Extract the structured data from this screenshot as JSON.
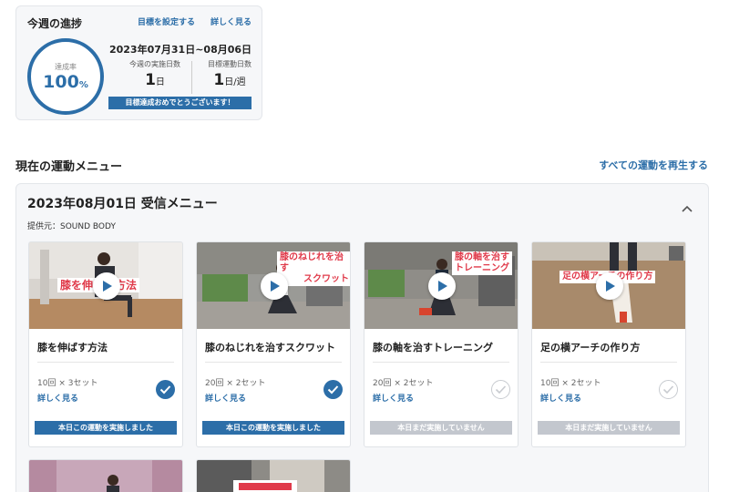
{
  "progress": {
    "title": "今週の進捗",
    "set_goal_link": "目標を設定する",
    "detail_link": "詳しく見る",
    "rate_label": "達成率",
    "rate_value": "100",
    "rate_unit": "%",
    "rate_fraction": 1.0,
    "period": "2023年07月31日~08月06日",
    "done_days_label": "今週の実施日数",
    "done_days_value": "1",
    "done_days_unit": "日",
    "goal_days_label": "目標運動日数",
    "goal_days_value": "1",
    "goal_days_unit": "日/週",
    "banner": "目標達成おめでとうございます！",
    "accent_color": "#2c6ea8"
  },
  "section": {
    "title": "現在の運動メニュー",
    "play_all": "すべての運動を再生する"
  },
  "menu": {
    "title": "2023年08月01日 受信メニュー",
    "provider": "提供元：SOUND BODY",
    "collapse_icon": "chevron-up-icon",
    "cards": [
      {
        "caption": "膝を伸ばす方法",
        "name": "膝を伸ばす方法",
        "reps": "10回 × 3セット",
        "detail": "詳しく見る",
        "status": "本日この運動を実施しました",
        "done": true
      },
      {
        "caption": "膝のねじれを治す スクワット",
        "name": "膝のねじれを治すスクワット",
        "reps": "20回 × 2セット",
        "detail": "詳しく見る",
        "status": "本日この運動を実施しました",
        "done": true
      },
      {
        "caption": "膝の軸を治す トレーニング",
        "name": "膝の軸を治すトレーニング",
        "reps": "20回 × 2セット",
        "detail": "詳しく見る",
        "status": "本日まだ実施していません",
        "done": false
      },
      {
        "caption": "足の横アーチの作り方",
        "name": "足の横アーチの作り方",
        "reps": "10回 × 2セット",
        "detail": "詳しく見る",
        "status": "本日まだ実施していません",
        "done": false
      }
    ]
  },
  "colors": {
    "accent": "#2c6ea8",
    "caption_red": "#e03a4a",
    "todo_gray": "#c3c7ce",
    "panel_bg": "#f6f7f9"
  }
}
